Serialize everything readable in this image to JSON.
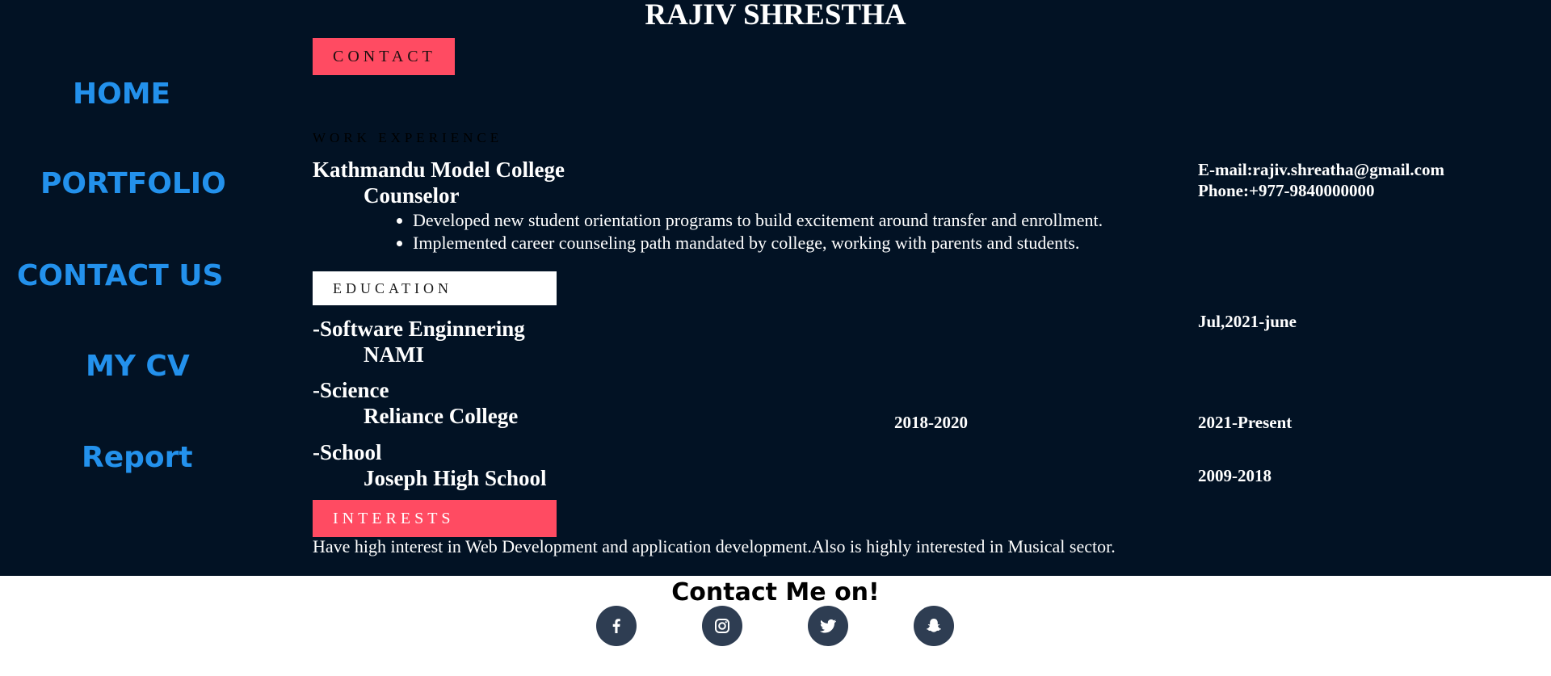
{
  "header": {
    "name": "RAJIV SHRESTHA"
  },
  "nav": {
    "home": "HOME",
    "portfolio": "PORTFOLIO",
    "contact_us": "CONTACT US",
    "my_cv": "MY CV",
    "report": "Report"
  },
  "sections": {
    "contact": "CONTACT",
    "work_experience": "WORK EXPERIENCE",
    "education": "EDUCATION",
    "interests": "INTERESTS"
  },
  "work": {
    "company": "Kathmandu Model College",
    "role": "Counselor",
    "duties": [
      "Developed new student orientation programs to build excitement around transfer and enrollment.",
      "Implemented career counseling path mandated by college, working with parents and students."
    ]
  },
  "contact_info": {
    "email": "E-mail:rajiv.shreatha@gmail.com",
    "phone": "Phone:+977-9840000000"
  },
  "education": [
    {
      "degree": "-Software Enginnering",
      "school": "NAMI",
      "date": "Jul,2021-june"
    },
    {
      "degree": "-Science",
      "school": "Reliance College",
      "date_mid": "2018-2020",
      "date": "2021-Present"
    },
    {
      "degree": "-School",
      "school": "Joseph High School",
      "date": "2009-2018"
    }
  ],
  "interests": {
    "text": "Have high interest in Web Development and application development.Also is highly interested in Musical sector."
  },
  "footer": {
    "title": "Contact Me on!",
    "icons": [
      "facebook-icon",
      "instagram-icon",
      "twitter-icon",
      "snapchat-icon"
    ],
    "icon_bg": "#2e3d52"
  },
  "colors": {
    "background": "#021224",
    "nav_link": "#2391ec",
    "accent": "#ff4b62"
  }
}
